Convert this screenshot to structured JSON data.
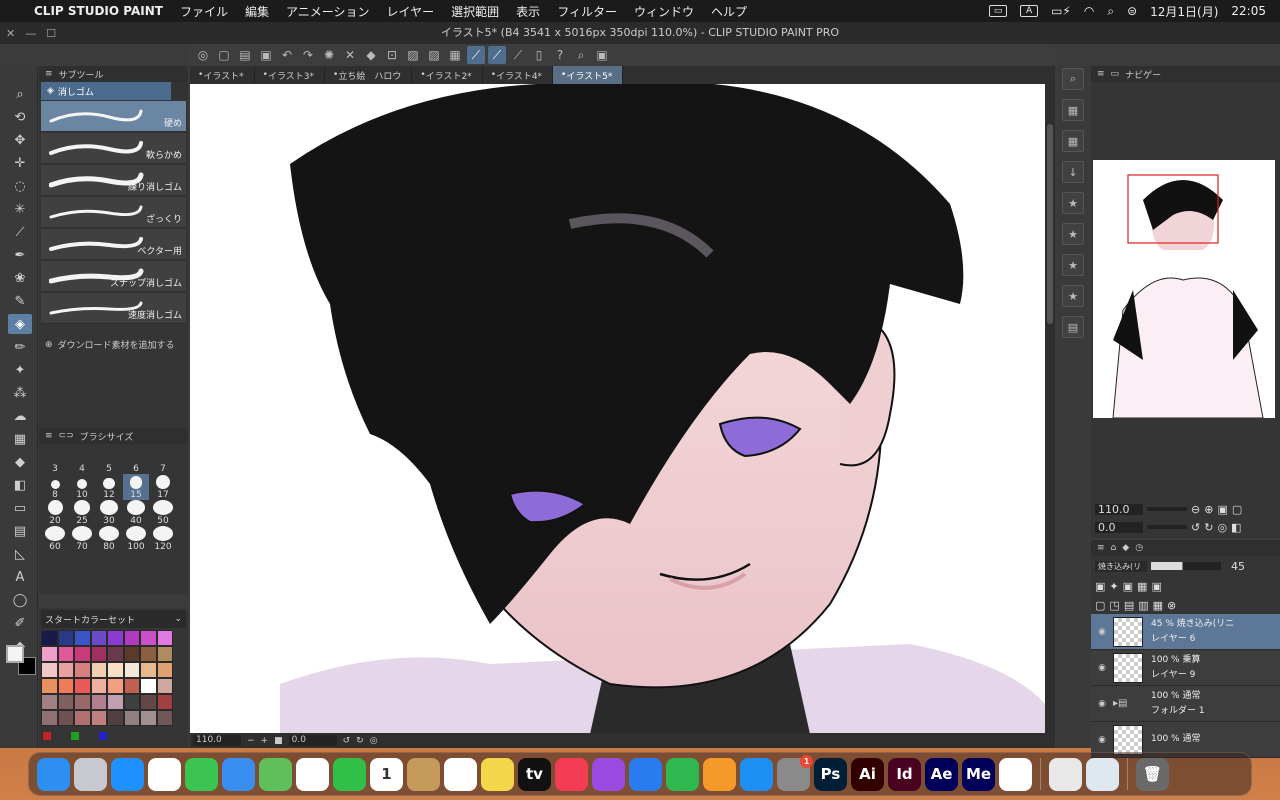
{
  "menubar": {
    "app_name": "CLIP STUDIO PAINT",
    "items": [
      "ファイル",
      "編集",
      "アニメーション",
      "レイヤー",
      "選択範囲",
      "表示",
      "フィルター",
      "ウィンドウ",
      "ヘルプ"
    ],
    "input_mode": "A",
    "date": "12月1日(月)",
    "time": "22:05"
  },
  "window": {
    "title": "イラスト5* (B4 3541 x 5016px 350dpi 110.0%)  - CLIP STUDIO PAINT PRO"
  },
  "subtool": {
    "tab_label": "サブツール",
    "group_label": "消しゴム",
    "brushes": [
      {
        "label": "硬め",
        "selected": true
      },
      {
        "label": "軟らかめ",
        "selected": false
      },
      {
        "label": "練り消しゴム",
        "selected": false
      },
      {
        "label": "ざっくり",
        "selected": false
      },
      {
        "label": "ベクター用",
        "selected": false
      },
      {
        "label": "スナップ消しゴム",
        "selected": false
      },
      {
        "label": "速度消しゴム",
        "selected": false
      }
    ],
    "download_label": "ダウンロード素材を追加する"
  },
  "brush_size": {
    "title": "ブラシサイズ",
    "sizes": [
      "3",
      "4",
      "5",
      "6",
      "7",
      "8",
      "10",
      "12",
      "15",
      "17",
      "20",
      "25",
      "30",
      "40",
      "50",
      "60",
      "70",
      "80",
      "100",
      "120"
    ],
    "selected": "15"
  },
  "color_set": {
    "name": "スタートカラーセット",
    "swatches": [
      "#1a1a4a",
      "#2a3a8a",
      "#3b55c8",
      "#6a4bc8",
      "#8a3bd0",
      "#b03bc0",
      "#c850c8",
      "#e07ae0",
      "#f0a0c8",
      "#e05a9a",
      "#c83a7a",
      "#a03060",
      "#6a3a4a",
      "#5a3a2a",
      "#8a6040",
      "#b08a60",
      "#f0c8c8",
      "#e8a0a0",
      "#d88080",
      "#f0d0b0",
      "#f8e0c8",
      "#f0e8d8",
      "#e8b890",
      "#e0a070",
      "#e89060",
      "#f07a5a",
      "#e85a5a",
      "#f0b0a0",
      "#f0a080",
      "#c06050",
      "#ffffff",
      "#d0a8a0",
      "#a08080",
      "#806060",
      "#9a6a6a",
      "#b08090",
      "#c0a0b0",
      "#404040",
      "#604848",
      "#a04040",
      "#907070",
      "#705050",
      "#b07070",
      "#c08080",
      "#504040",
      "#908080",
      "#a09090",
      "#705858"
    ],
    "bottom_colors": [
      "#cc2020",
      "#20a020",
      "#2020cc"
    ]
  },
  "document_tabs": [
    {
      "label": "イラスト*",
      "active": false
    },
    {
      "label": "イラスト3*",
      "active": false
    },
    {
      "label": "立ち絵　ハロウ",
      "active": false
    },
    {
      "label": "イラスト2*",
      "active": false
    },
    {
      "label": "イラスト4*",
      "active": false
    },
    {
      "label": "イラスト5*",
      "active": true
    }
  ],
  "canvas_status": {
    "zoom": "110.0",
    "rotation": "0.0"
  },
  "navigator": {
    "title": "ナビゲー",
    "zoom": "110.0",
    "rotation": "0.0"
  },
  "layers_panel": {
    "blend_mode": "焼き込み(リ",
    "opacity": "45",
    "layers": [
      {
        "top": "45 %  焼き込み(リニ",
        "name": "レイヤー 6",
        "active": true
      },
      {
        "top": "100 %  乗算",
        "name": "レイヤー 9",
        "active": false
      },
      {
        "top": "100 %  通常",
        "name": "フォルダー 1",
        "active": false,
        "folder": true
      },
      {
        "top": "100 %  通常",
        "name": "",
        "active": false
      }
    ]
  },
  "dock": {
    "apps": [
      {
        "name": "Finder",
        "label": "",
        "bg": "#2d8ff0"
      },
      {
        "name": "Launchpad",
        "label": "",
        "bg": "#c8c8d0"
      },
      {
        "name": "Safari",
        "label": "",
        "bg": "#1e90ff"
      },
      {
        "name": "Chrome",
        "label": "",
        "bg": "#ffffff"
      },
      {
        "name": "Messages",
        "label": "",
        "bg": "#3bc451"
      },
      {
        "name": "Mail",
        "label": "",
        "bg": "#3a8ef0"
      },
      {
        "name": "Maps",
        "label": "",
        "bg": "#5fbf5a"
      },
      {
        "name": "Photos",
        "label": "",
        "bg": "#ffffff"
      },
      {
        "name": "FaceTime",
        "label": "",
        "bg": "#30c04a"
      },
      {
        "name": "Calendar",
        "label": "1",
        "bg": "#ffffff"
      },
      {
        "name": "Contacts",
        "label": "",
        "bg": "#c69a5a"
      },
      {
        "name": "Reminders",
        "label": "",
        "bg": "#ffffff"
      },
      {
        "name": "Notes",
        "label": "",
        "bg": "#f5d54a"
      },
      {
        "name": "TV",
        "label": "tv",
        "bg": "#111111"
      },
      {
        "name": "Music",
        "label": "",
        "bg": "#f53c55"
      },
      {
        "name": "Podcasts",
        "label": "",
        "bg": "#9a4ae0"
      },
      {
        "name": "Keynote",
        "label": "",
        "bg": "#2a7af0"
      },
      {
        "name": "Numbers",
        "label": "",
        "bg": "#2fb850"
      },
      {
        "name": "Pages",
        "label": "",
        "bg": "#f59a2a"
      },
      {
        "name": "App Store",
        "label": "",
        "bg": "#1e8ff5"
      },
      {
        "name": "System Settings",
        "label": "",
        "bg": "#8a8a8a",
        "badge": "1"
      },
      {
        "name": "Photoshop",
        "label": "Ps",
        "bg": "#001e36"
      },
      {
        "name": "Illustrator",
        "label": "Ai",
        "bg": "#330000"
      },
      {
        "name": "InDesign",
        "label": "Id",
        "bg": "#49021f"
      },
      {
        "name": "After Effects",
        "label": "Ae",
        "bg": "#00005b"
      },
      {
        "name": "Media Encoder",
        "label": "Me",
        "bg": "#00005b"
      },
      {
        "name": "Clip Studio",
        "label": "",
        "bg": "#ffffff"
      },
      {
        "name": "Clip Studio Paint",
        "label": "",
        "bg": "#e8e8e8"
      },
      {
        "name": "Preview",
        "label": "",
        "bg": "#dfe8f0"
      }
    ]
  },
  "colors": {
    "accent": "#5c7fa3",
    "panel": "#353535",
    "menubar": "#1b1b1b"
  }
}
